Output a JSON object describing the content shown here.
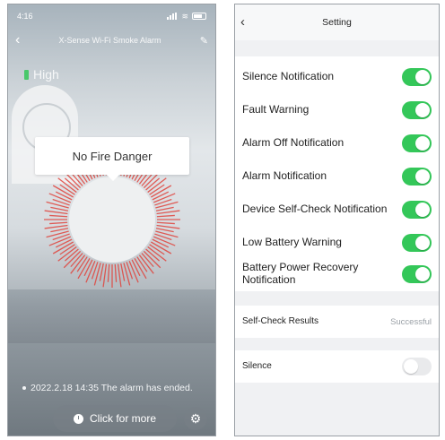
{
  "left": {
    "status_time": "4:16",
    "nav_title": "X-Sense Wi-Fi Smoke Alarm",
    "level_text": "High",
    "bubble_text": "No Fire Danger",
    "event_text": "2022.2.18 14:35 The alarm has ended.",
    "more_button": "Click for more",
    "colors": {
      "ring": "#e0443d",
      "level_indicator": "#34c759"
    }
  },
  "right": {
    "title": "Setting",
    "toggles": [
      {
        "label": "Silence Notification",
        "on": true
      },
      {
        "label": "Fault Warning",
        "on": true
      },
      {
        "label": "Alarm Off Notification",
        "on": true
      },
      {
        "label": "Alarm Notification",
        "on": true
      },
      {
        "label": "Device Self-Check Notification",
        "on": true
      },
      {
        "label": "Low Battery Warning",
        "on": true
      },
      {
        "label": "Battery Power Recovery Notification",
        "on": true
      }
    ],
    "self_check": {
      "label": "Self-Check Results",
      "value": "Successful"
    },
    "silence": {
      "label": "Silence",
      "on": false
    },
    "colors": {
      "toggle_on": "#34c759",
      "toggle_off": "#e9eaec"
    }
  },
  "icons": {
    "back": "chevron-left-icon",
    "edit": "pencil-icon",
    "fire": "flame-icon",
    "history": "clock-icon",
    "settings": "gear-icon"
  }
}
